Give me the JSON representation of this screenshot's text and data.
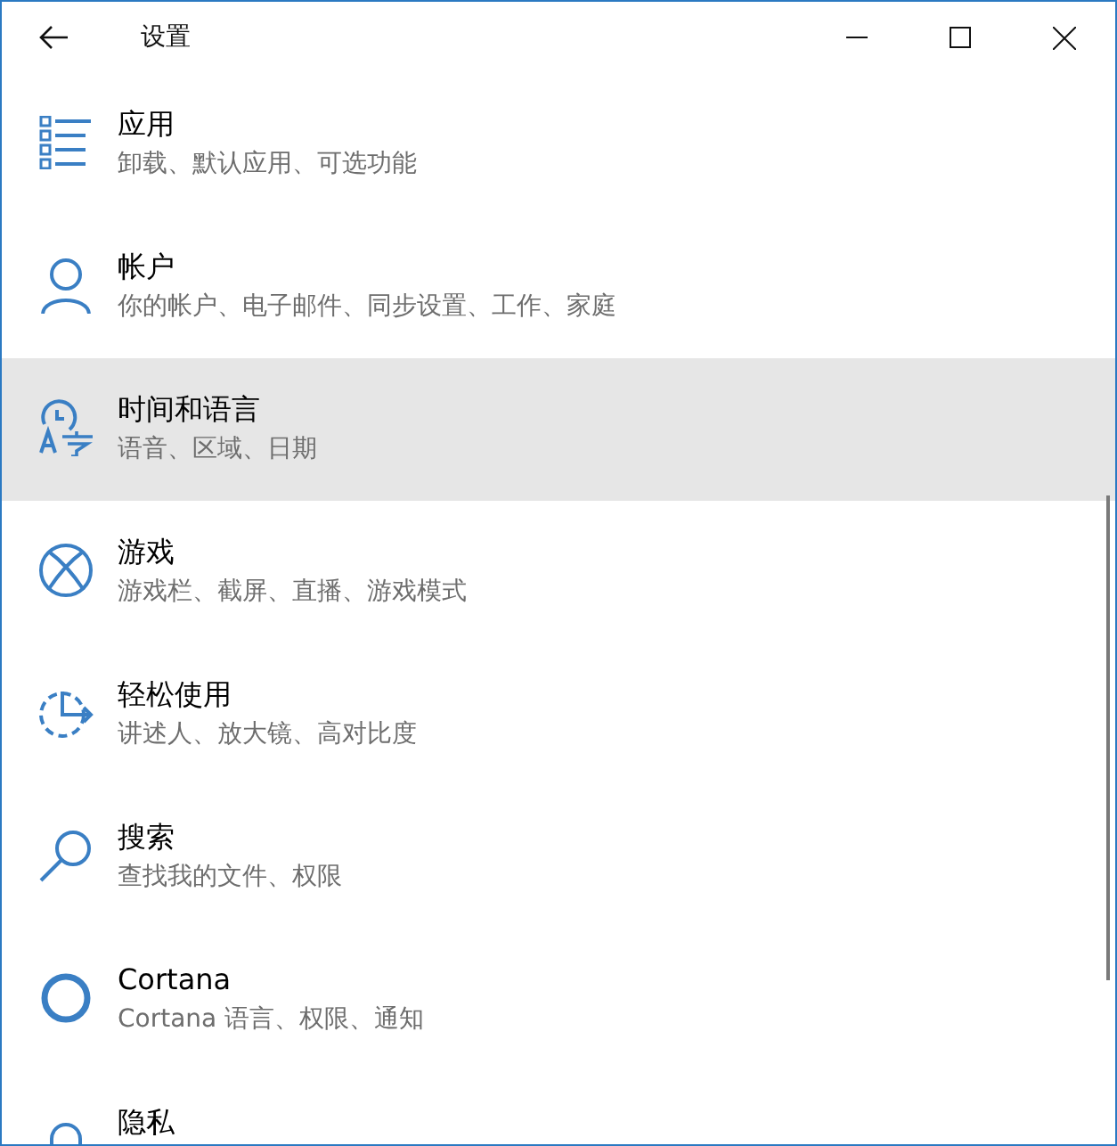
{
  "window": {
    "title": "设置"
  },
  "items": [
    {
      "kind": "apps",
      "title": "应用",
      "subtitle": "卸载、默认应用、可选功能",
      "selected": false
    },
    {
      "kind": "accounts",
      "title": "帐户",
      "subtitle": "你的帐户、电子邮件、同步设置、工作、家庭",
      "selected": false
    },
    {
      "kind": "time-language",
      "title": "时间和语言",
      "subtitle": "语音、区域、日期",
      "selected": true
    },
    {
      "kind": "gaming",
      "title": "游戏",
      "subtitle": "游戏栏、截屏、直播、游戏模式",
      "selected": false
    },
    {
      "kind": "ease",
      "title": "轻松使用",
      "subtitle": "讲述人、放大镜、高对比度",
      "selected": false
    },
    {
      "kind": "search",
      "title": "搜索",
      "subtitle": "查找我的文件、权限",
      "selected": false
    },
    {
      "kind": "cortana",
      "title": "Cortana",
      "subtitle": "Cortana 语言、权限、通知",
      "selected": false
    },
    {
      "kind": "privacy",
      "title": "隐私",
      "selected": false
    }
  ]
}
